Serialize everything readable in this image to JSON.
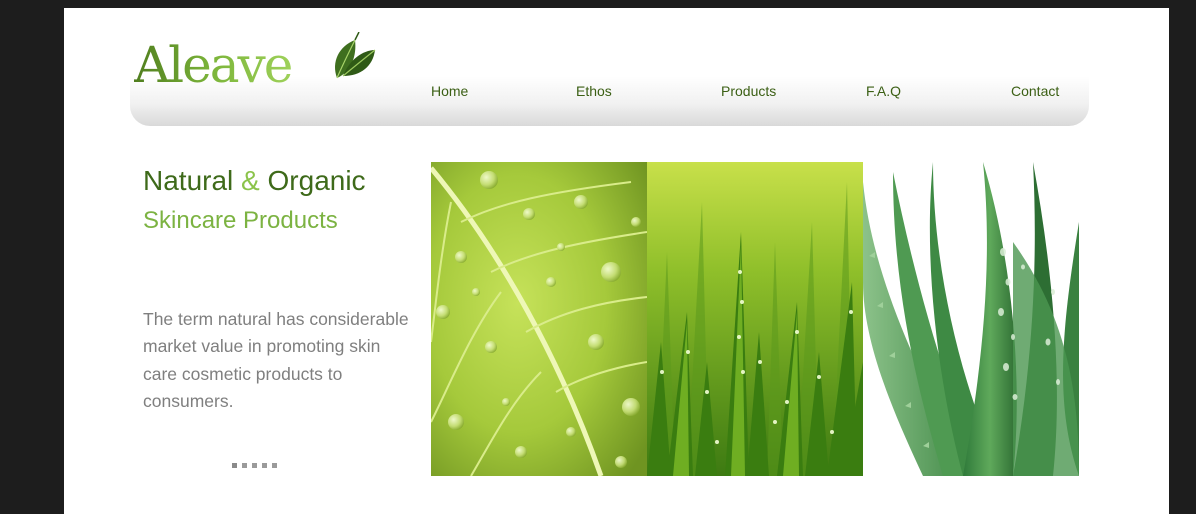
{
  "brand": {
    "name": "Aleave",
    "logo_icon": "leaf-icon"
  },
  "nav": {
    "items": [
      {
        "label": "Home"
      },
      {
        "label": "Ethos"
      },
      {
        "label": "Products"
      },
      {
        "label": "F.A.Q"
      },
      {
        "label": "Contact"
      }
    ]
  },
  "hero": {
    "headline_part1": "Natural",
    "headline_amp": "&",
    "headline_part2": "Organic",
    "subheadline": "Skincare Products",
    "body": "The term natural has considerable market value in promoting skin care cosmetic products to consumers."
  },
  "slider": {
    "count": 5,
    "active_index": 0
  },
  "gallery": {
    "images": [
      {
        "name": "leaf-with-water-drops"
      },
      {
        "name": "dewy-grass"
      },
      {
        "name": "aloe-vera-plant"
      }
    ]
  },
  "colors": {
    "accent": "#7cb342",
    "dark_green": "#3e6a1a",
    "text_gray": "#7f7f7f",
    "frame": "#1d1d1d"
  }
}
